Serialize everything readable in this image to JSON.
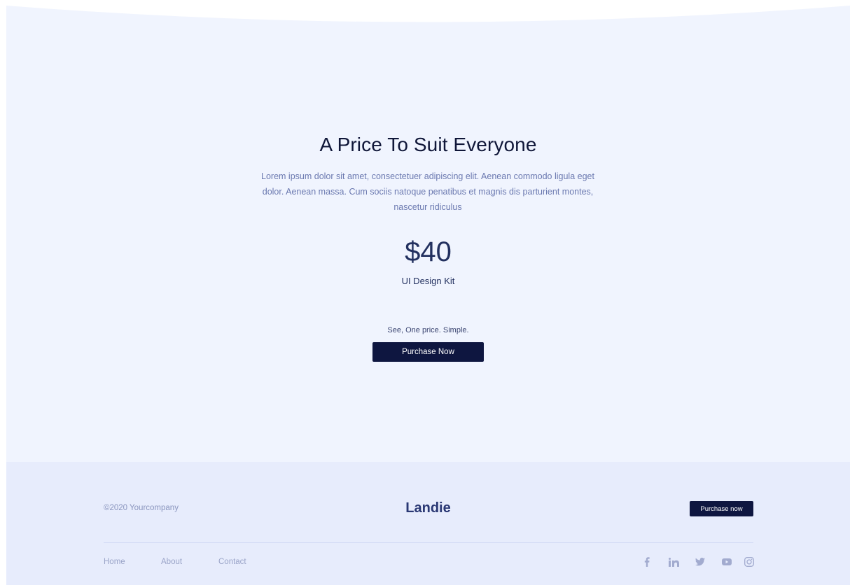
{
  "hero": {
    "title": "A Price To Suit Everyone",
    "description": "Lorem ipsum dolor sit amet, consectetuer adipiscing elit. Aenean commodo ligula eget dolor. Aenean massa. Cum sociis natoque penatibus et magnis dis parturient montes, nascetur ridiculus",
    "price": "$40",
    "product": "UI Design Kit",
    "tagline": "See, One price. Simple.",
    "cta_label": "Purchase Now"
  },
  "footer": {
    "copyright": "©2020 Yourcompany",
    "brand": "Landie",
    "cta_label": "Purchase now",
    "nav": [
      "Home",
      "About",
      "Contact"
    ],
    "social": [
      "facebook-icon",
      "linkedin-icon",
      "twitter-icon",
      "youtube-icon",
      "instagram-icon"
    ]
  },
  "colors": {
    "hero_bg": "#f0f4fe",
    "footer_bg": "#e7ecfc",
    "primary": "#0e1640",
    "brand": "#2a3874",
    "muted_text": "#6b79b0"
  }
}
